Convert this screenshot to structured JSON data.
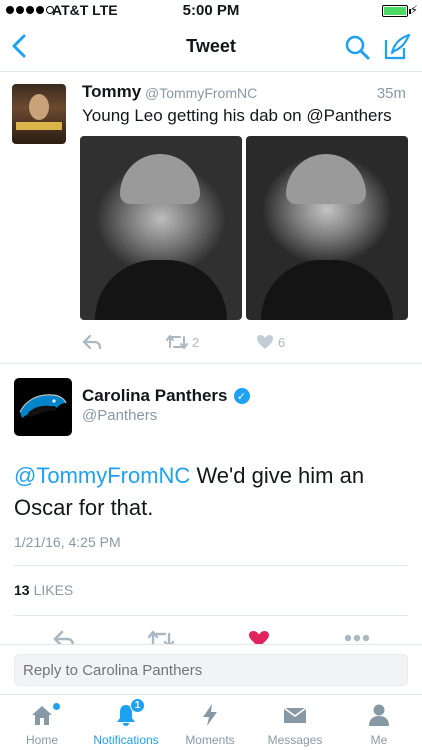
{
  "status_bar": {
    "carrier": "AT&T  LTE",
    "time": "5:00 PM"
  },
  "nav": {
    "title": "Tweet"
  },
  "parent_tweet": {
    "name": "Tommy",
    "handle": "@TommyFromNC",
    "time": "35m",
    "text": "Young Leo getting his dab on @Panthers",
    "retweets": "2",
    "likes": "6"
  },
  "main_tweet": {
    "name": "Carolina Panthers",
    "handle": "@Panthers",
    "mention": "@TommyFromNC",
    "text": " We'd give him an Oscar for that.",
    "date": "1/21/16, 4:25 PM",
    "likes_count": "13",
    "likes_label": "LIKES"
  },
  "reply": {
    "placeholder": "Reply to Carolina Panthers"
  },
  "tabs": [
    {
      "label": "Home",
      "icon": "home-icon"
    },
    {
      "label": "Notifications",
      "icon": "bell-icon",
      "badge": "1"
    },
    {
      "label": "Moments",
      "icon": "lightning-icon"
    },
    {
      "label": "Messages",
      "icon": "envelope-icon"
    },
    {
      "label": "Me",
      "icon": "person-icon"
    }
  ],
  "colors": {
    "accent": "#1da1f2",
    "like": "#e0245e",
    "muted": "#8899a6"
  }
}
